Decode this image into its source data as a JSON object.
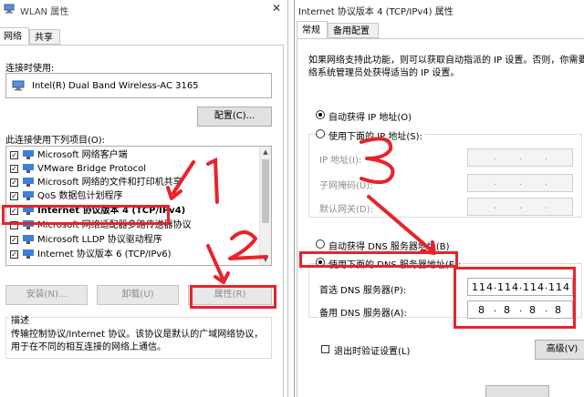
{
  "left_window": {
    "title": "WLAN 属性",
    "tabs": [
      {
        "label": "网络",
        "active": true
      },
      {
        "label": "共享",
        "active": false
      }
    ],
    "connect_using_label": "连接时使用:",
    "adapter_name": "Intel(R) Dual Band Wireless-AC 3165",
    "configure_button": "配置(C)...",
    "items_label": "此连接使用下列项目(O):",
    "items": [
      {
        "label": "Microsoft 网络客户端",
        "checked": true
      },
      {
        "label": "VMware Bridge Protocol",
        "checked": true
      },
      {
        "label": "Microsoft 网络的文件和打印机共享",
        "checked": true
      },
      {
        "label": "QoS 数据包计划程序",
        "checked": true
      },
      {
        "label": "Internet 协议版本 4 (TCP/IPv4)",
        "checked": true
      },
      {
        "label": "Microsoft 网络适配器多路传送器协议",
        "checked": false
      },
      {
        "label": "Microsoft LLDP 协议驱动程序",
        "checked": true
      },
      {
        "label": "Internet 协议版本 6 (TCP/IPv6)",
        "checked": true
      }
    ],
    "install_button": "安装(N)...",
    "uninstall_button": "卸载(U)",
    "properties_button": "属性(R)",
    "description_label": "描述",
    "description_text": "传输控制协议/Internet 协议。该协议是默认的广域网络协议，用于在不同的相互连接的网络上通信。"
  },
  "right_window": {
    "title": "Internet 协议版本 4 (TCP/IPv4) 属性",
    "tabs": [
      {
        "label": "常规",
        "active": true
      },
      {
        "label": "备用配置",
        "active": false
      }
    ],
    "intro_line1": "如果网络支持此功能，则可以获取自动指派的 IP 设置。否则，你需要从",
    "intro_line2": "络系统管理员处获得适当的 IP 设置。",
    "auto_ip": "自动获得 IP 地址(O)",
    "manual_ip": "使用下面的 IP 地址(S):",
    "ip_address_label": "IP 地址(I):",
    "subnet_label": "子网掩码(U):",
    "gateway_label": "默认网关(D):",
    "auto_dns": "自动获得 DNS 服务器地址(B)",
    "manual_dns": "使用下面的 DNS 服务器地址(E):",
    "preferred_dns_label": "首选 DNS 服务器(P):",
    "alternate_dns_label": "备用 DNS 服务器(A):",
    "preferred_dns": [
      "114",
      "114",
      "114",
      "114"
    ],
    "alternate_dns": [
      "8",
      "8",
      "8",
      "8"
    ],
    "validate_on_exit": "退出时验证设置(L)",
    "advanced_button": "高级(V)",
    "ip_mode": "auto",
    "dns_mode": "manual"
  },
  "annotations": {
    "number_1": "1",
    "number_2": "2",
    "number_3": "3"
  },
  "colors": {
    "highlight_red": "#e8232a",
    "accent_blue": "#0078d7"
  }
}
